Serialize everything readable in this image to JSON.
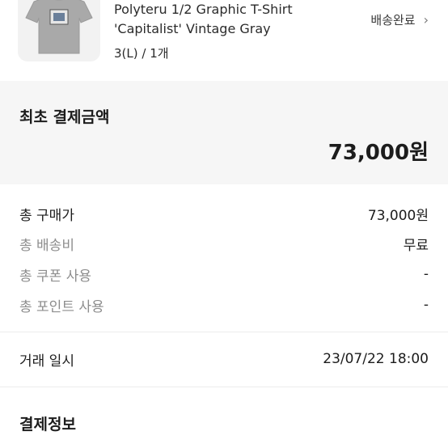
{
  "product": {
    "name_line1": "Polyteru 1/2 Graphic T-Shirt",
    "name_line2": "'Capitalist' Vintage Gray",
    "option": "3(L) / 1개",
    "status": "배송완료",
    "status_icon": "chevron-right-icon",
    "image": "gray-tshirt-thumbnail"
  },
  "initial_payment": {
    "title": "최초 결제금액",
    "amount": "73,000원"
  },
  "breakdown": [
    {
      "label": "총 구매가",
      "value": "73,000원"
    },
    {
      "label": "총 배송비",
      "value": "무료"
    },
    {
      "label": "총 쿠폰 사용",
      "value": "-"
    },
    {
      "label": "총 포인트 사용",
      "value": "-"
    }
  ],
  "transaction": {
    "label": "거래 일시",
    "value": "23/07/22 18:00"
  },
  "payment_info": {
    "title": "결제정보"
  },
  "colors": {
    "background": "#ffffff",
    "panel": "#f6f6f6",
    "text": "#1c1c1c",
    "muted": "#8d8d8d",
    "divider": "#ececec"
  }
}
